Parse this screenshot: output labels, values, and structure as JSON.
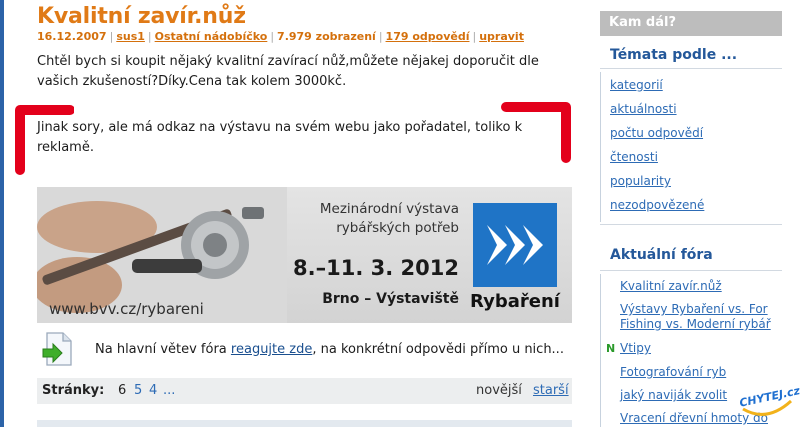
{
  "post": {
    "title": "Kvalitní zavír.nůž",
    "meta": {
      "date": "16.12.2007",
      "author": "sus1",
      "category": "Ostatní nádobíčko",
      "views": "7.979 zobrazení",
      "replies": "179 odpovědí",
      "edit": "upravit"
    },
    "paragraph1": "Chtěl bych si koupit nějaký kvalitní zavírací nůž,můžete nějakej doporučit dle vašich zkušeností?Díky.Cena tak kolem 3000kč.",
    "paragraph2": "Jinak sory, ale má odkaz na výstavu na svém webu jako pořadatel, toliko k reklamě."
  },
  "banner": {
    "headline_line1": "Mezinárodní výstava",
    "headline_line2": "rybářských potřeb",
    "dates": "8.–11. 3. 2012",
    "venue": "Brno – Výstaviště",
    "url": "www.bvv.cz/rybareni",
    "logo_text": "Rybaření"
  },
  "reply": {
    "prefix": "Na hlavní větev fóra",
    "link": "reagujte zde",
    "suffix": ", na konkrétní odpovědi přímo u nich..."
  },
  "pager": {
    "label": "Stránky:",
    "current": "6",
    "pages": [
      "5",
      "4",
      "..."
    ],
    "newer": "novější",
    "older": "starší"
  },
  "sidebar": {
    "box_title": "Kam dál?",
    "topics_heading": "Témata podle ...",
    "topics": [
      "kategorií",
      "aktuálnosti",
      "počtu odpovědí",
      "čtenosti",
      "popularity",
      "nezodpovězené"
    ],
    "forums_heading": "Aktuální fóra",
    "forums": [
      {
        "label": "Kvalitní zavír.nůž",
        "new": ""
      },
      {
        "label": "Výstavy Rybaření vs. For Fishing vs. Moderní rybář",
        "new": ""
      },
      {
        "label": "Vtipy",
        "new": "N"
      },
      {
        "label": "Fotografování ryb",
        "new": ""
      },
      {
        "label": "jaký naviják zvolit",
        "new": ""
      },
      {
        "label": "Vracení dřevní hmoty do",
        "new": ""
      }
    ]
  },
  "watermark": "CHYTEJ.cz",
  "colors": {
    "title_orange": "#e07a16",
    "link_blue": "#2d6bb5",
    "heading_blue": "#24589a",
    "marker_red": "#e3001b",
    "logo_blue": "#1f74c6"
  }
}
